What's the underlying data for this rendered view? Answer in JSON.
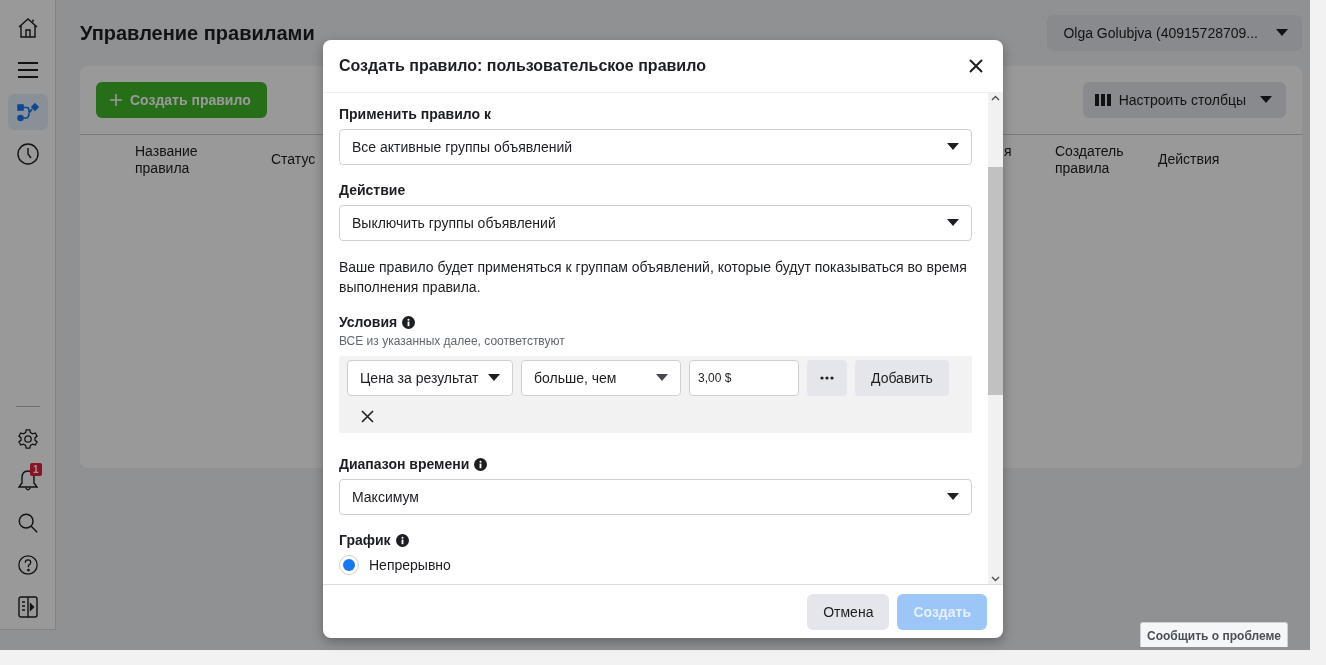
{
  "sidebar": {
    "top_items": [
      {
        "kind": "home",
        "selected": false
      },
      {
        "kind": "menu",
        "selected": false
      },
      {
        "kind": "rules",
        "selected": true
      },
      {
        "kind": "history",
        "selected": false
      }
    ],
    "bottom_items": [
      {
        "kind": "settings",
        "selected": false
      },
      {
        "kind": "bell",
        "selected": false,
        "badge": "1"
      },
      {
        "kind": "search",
        "selected": false
      },
      {
        "kind": "help",
        "selected": false
      },
      {
        "kind": "panel",
        "selected": false
      }
    ]
  },
  "page_title": "Управление правилами",
  "account_selector": {
    "value": "Olga Golubjva (40915728709..."
  },
  "create_button": "Создать правило",
  "columns_button": "Настроить столбцы",
  "table": {
    "columns": [
      "Название правила",
      "Статус",
      "я",
      "Создатель правила",
      "Действия"
    ]
  },
  "dialog": {
    "title": "Создать правило: пользовательское правило",
    "apply_to": {
      "label": "Применить правило к",
      "value": "Все активные группы объявлений"
    },
    "action": {
      "label": "Действие",
      "value": "Выключить группы объявлений"
    },
    "note": "Ваше правило будет применяться к группам объявлений, которые будут показываться во время выполнения правила.",
    "conditions": {
      "label": "Условия",
      "subtitle": "ВСЕ из указанных далее, соответствуют",
      "metric": "Цена за результат",
      "operator": "больше, чем",
      "value": "3,00 $",
      "add_button": "Добавить"
    },
    "time_range": {
      "label": "Диапазон времени",
      "value": "Максимум"
    },
    "schedule": {
      "label": "График",
      "options": [
        {
          "label": "Непрерывно",
          "selected": true
        }
      ]
    },
    "cancel_button": "Отмена",
    "create_button": {
      "label": "Создать",
      "disabled": true
    }
  },
  "report_button": "Сообщить о проблеме"
}
